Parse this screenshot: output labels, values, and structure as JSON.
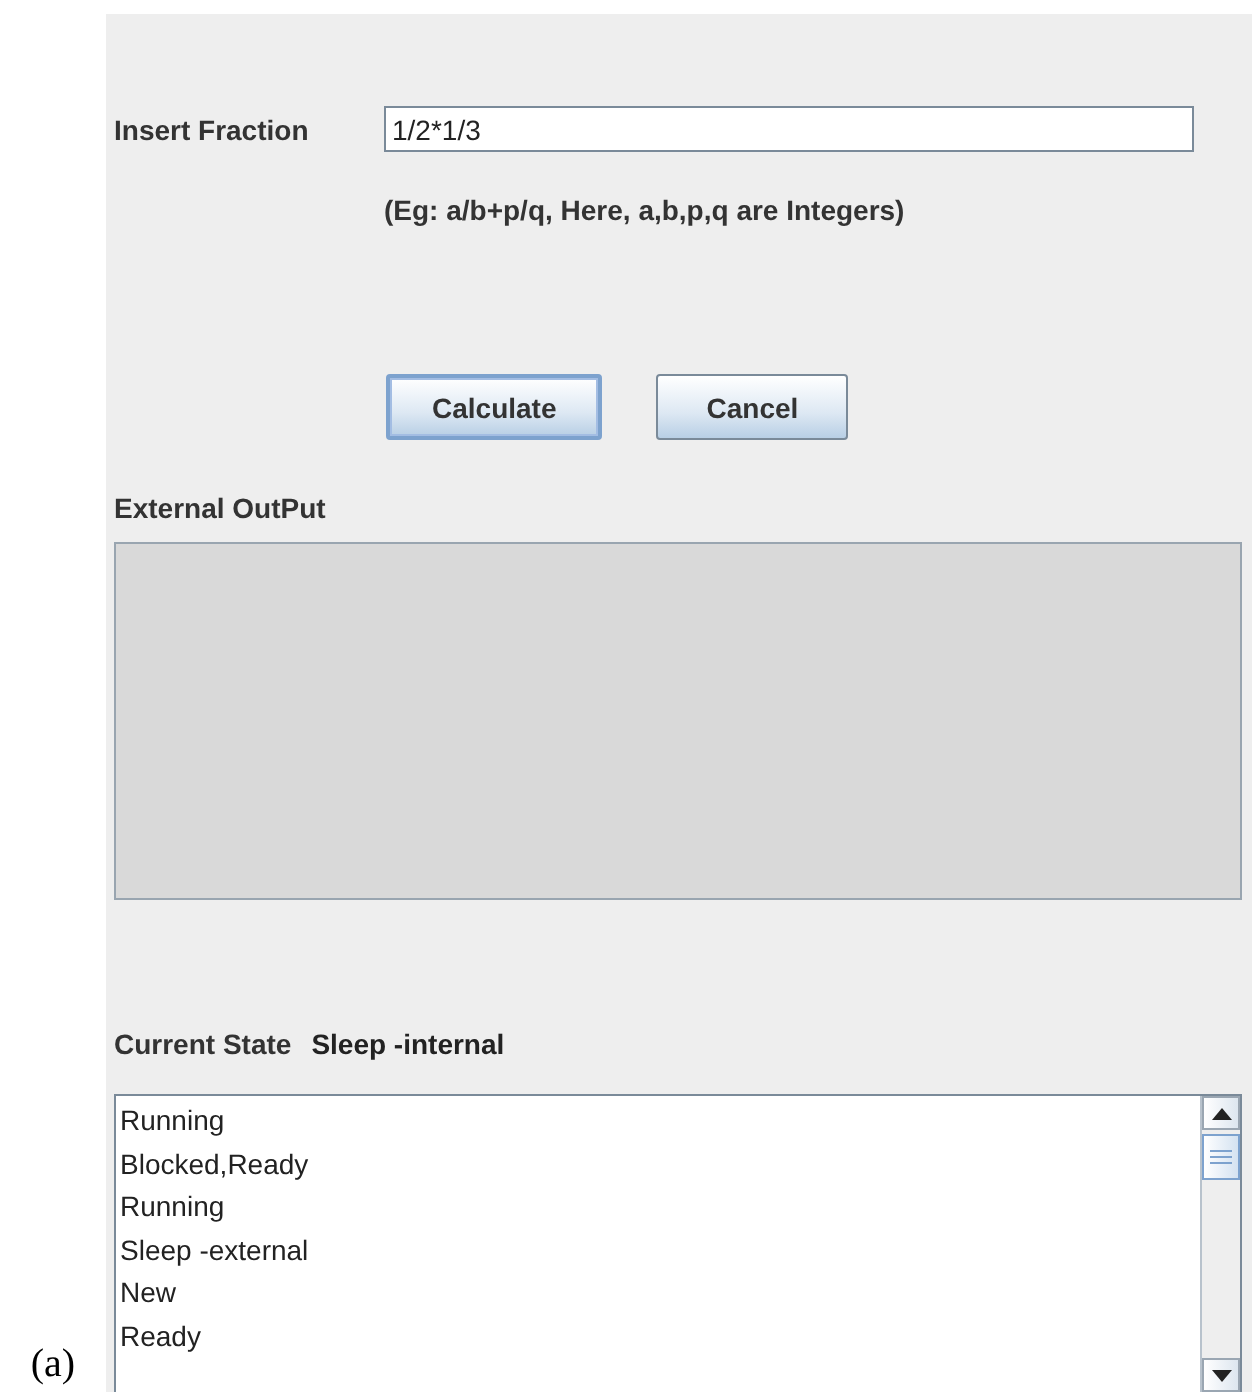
{
  "figure_label": "(a)",
  "form": {
    "fraction_label": "Insert Fraction",
    "fraction_value": "1/2*1/3",
    "hint": "(Eg: a/b+p/q, Here, a,b,p,q are Integers)"
  },
  "buttons": [
    {
      "label": "Calculate",
      "focused": true
    },
    {
      "label": "Cancel",
      "focused": false
    }
  ],
  "output": {
    "label": "External OutPut"
  },
  "current_state": {
    "label": "Current State",
    "value": "Sleep -internal"
  },
  "state_log": [
    "Running",
    "Blocked,Ready",
    "Running",
    "Sleep -external",
    "New",
    "Ready"
  ]
}
